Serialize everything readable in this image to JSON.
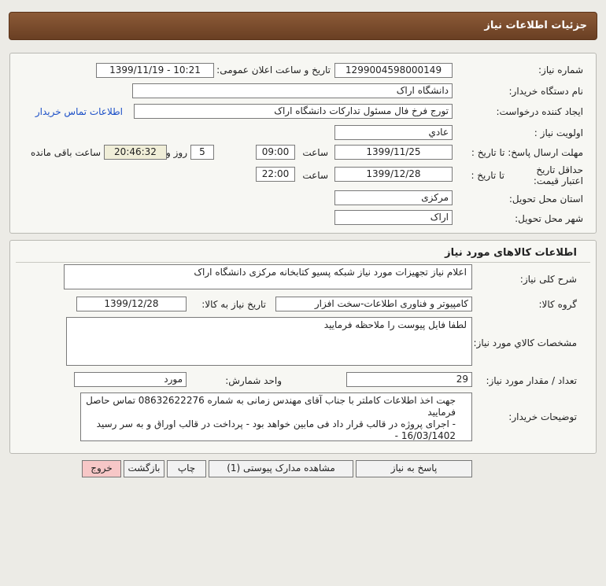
{
  "header": {
    "title": "جزئیات اطلاعات نیاز"
  },
  "details": {
    "need_number_label": "شماره نیاز:",
    "need_number": "1299004598000149",
    "announce_label": "تاریخ و ساعت اعلان عمومی:",
    "announce_value": "1399/11/19 - 10:21",
    "buyer_label": "نام دستگاه خریدار:",
    "buyer_value": "دانشگاه اراک",
    "creator_label": "ایجاد کننده درخواست:",
    "creator_value": "تورج فرخ فال مسئول تدارکات دانشگاه اراک",
    "contact_link": "اطلاعات تماس خریدار",
    "priority_label": "اولویت نیاز :",
    "priority_value": "عادي",
    "deadline_label": "مهلت ارسال پاسخ: تا تاریخ :",
    "deadline_date": "1399/11/25",
    "time_label": "ساعت",
    "deadline_time": "09:00",
    "days_value": "5",
    "days_label": "روز و",
    "remaining_time": "20:46:32",
    "remaining_label": "ساعت باقی مانده",
    "validity_label": "حداقل تاریخ اعتبار قیمت:",
    "validity_to_label": "تا تاریخ :",
    "validity_date": "1399/12/28",
    "validity_time_label": "ساعت",
    "validity_time": "22:00",
    "province_label": "استان محل تحویل:",
    "province_value": "مرکزی",
    "city_label": "شهر محل تحویل:",
    "city_value": "اراک"
  },
  "goods": {
    "section_title": "اطلاعات کالاهای مورد نیاز",
    "summary_label": "شرح کلی نیاز:",
    "summary_value": "اعلام نیاز تجهیزات مورد نیاز شبکه پسیو کتابخانه مرکزی دانشگاه اراک",
    "group_label": "گروه کالا:",
    "group_value": "کامپیوتر و فناوری اطلاعات-سخت افزار",
    "need_date_label": "تاریخ نیاز به کالا:",
    "need_date_value": "1399/12/28",
    "specs_label": "مشخصات کالاي مورد نیاز:",
    "specs_value": "لطفا فایل پیوست را ملاحظه فرمایید",
    "qty_label": "تعداد / مقدار مورد نیاز:",
    "qty_value": "29",
    "unit_label": "واحد شمارش:",
    "unit_value": "مورد",
    "notes_label": "توضیحات خریدار:",
    "notes_line1": "جهت اخذ اطلاعات کاملتر با جناب آقای مهندس زمانی به شماره 08632622276 تماس حاصل فرمایید",
    "notes_line2": "- اجرای پروژه در قالب قرار داد فی مابین خواهد بود - پرداخت در قالب اوراق و به سر رسید 16/03/1402 -"
  },
  "actions": {
    "reply": "پاسخ به نیاز",
    "attachments": "مشاهده مدارک پیوستی (1)",
    "print": "چاپ",
    "back": "بازگشت",
    "exit": "خروج"
  }
}
